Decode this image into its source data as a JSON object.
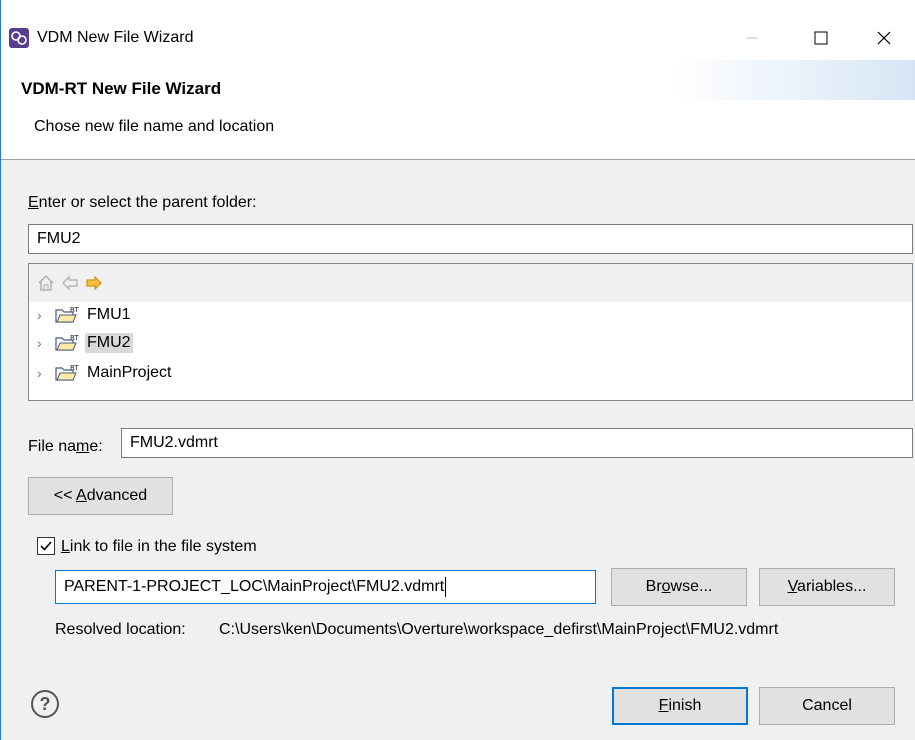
{
  "window": {
    "title": "VDM New File Wizard"
  },
  "header": {
    "title": "VDM-RT New File Wizard",
    "description": "Chose new file name and location"
  },
  "parent_folder": {
    "label_accel": "E",
    "label_rest": "nter or select the parent folder:",
    "value": "FMU2"
  },
  "tree": {
    "items": [
      {
        "label": "FMU1",
        "selected": false
      },
      {
        "label": "FMU2",
        "selected": true
      },
      {
        "label": "MainProject",
        "selected": false
      }
    ]
  },
  "file_name": {
    "label_pre": "File na",
    "label_accel": "m",
    "label_post": "e:",
    "value": "FMU2.vdmrt"
  },
  "advanced_button": {
    "label_pre": "<< ",
    "label_accel": "A",
    "label_post": "dvanced"
  },
  "link": {
    "checked": true,
    "label_accel": "L",
    "label_rest": "ink to file in the file system",
    "path_value": "PARENT-1-PROJECT_LOC\\MainProject\\FMU2.vdmrt",
    "browse_pre": "Br",
    "browse_accel": "o",
    "browse_post": "wse...",
    "variables_accel": "V",
    "variables_rest": "ariables...",
    "resolved_label": "Resolved location:",
    "resolved_value": "C:\\Users\\ken\\Documents\\Overture\\workspace_defirst\\MainProject\\FMU2.vdmrt"
  },
  "footer": {
    "help_glyph": "?",
    "finish_accel": "F",
    "finish_rest": "inish",
    "cancel_label": "Cancel"
  },
  "colors": {
    "accent": "#0078d7",
    "window_border": "#2b79c9",
    "dialog_bg": "#f0f0f0",
    "app_icon": "#5a3d8f"
  }
}
